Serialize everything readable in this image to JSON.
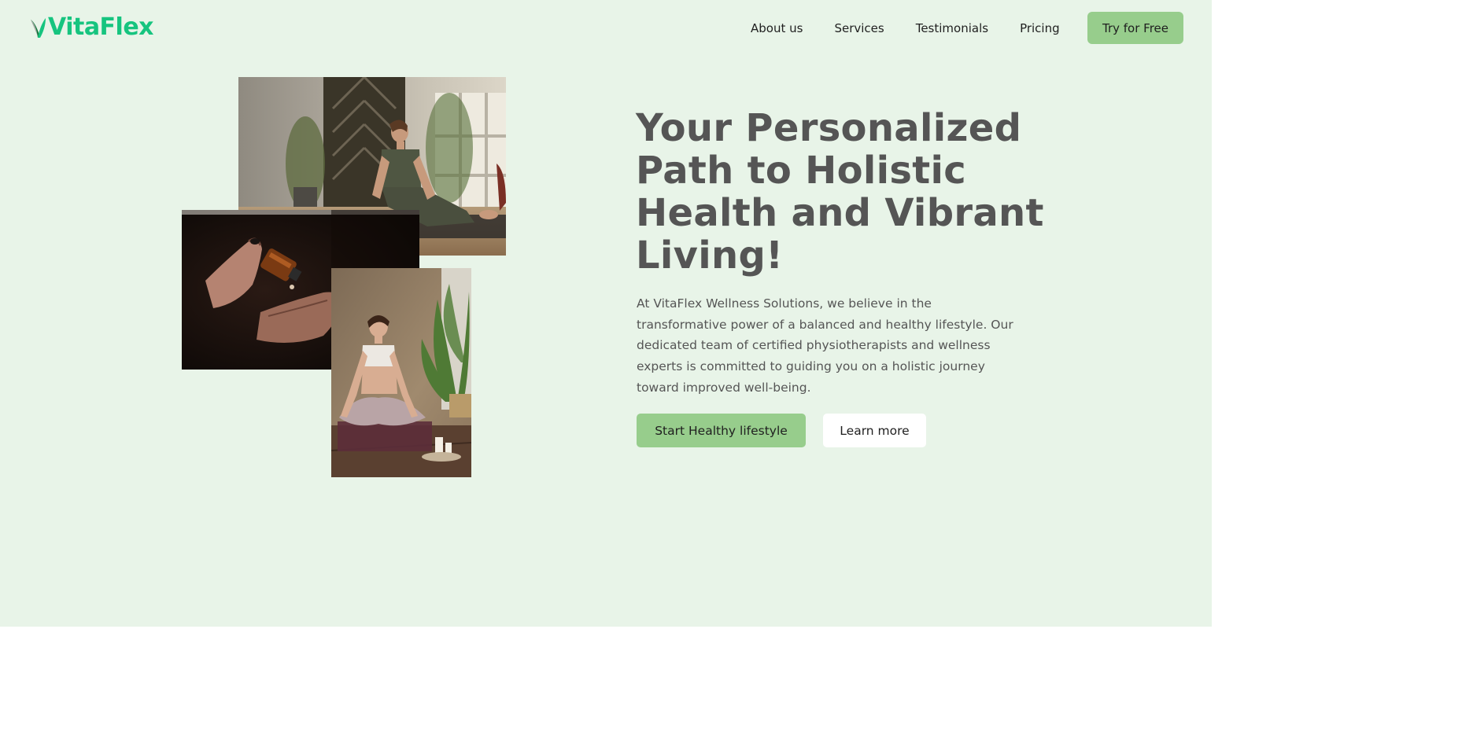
{
  "brand": {
    "name": "VitaFlex",
    "logo_icon": "leaf-icon",
    "color": "#16c47f"
  },
  "nav": {
    "items": [
      {
        "label": "About us"
      },
      {
        "label": "Services"
      },
      {
        "label": "Testimonials"
      },
      {
        "label": "Pricing"
      }
    ],
    "cta_label": "Try for Free"
  },
  "hero": {
    "title": "Your Personalized Path to Holistic Health and Vibrant Living!",
    "description": "At VitaFlex Wellness Solutions, we believe in the transformative power of a balanced and healthy lifestyle. Our dedicated team of certified physiotherapists and wellness experts is committed to guiding you on a holistic journey toward improved well-being.",
    "primary_button": "Start Healthy lifestyle",
    "secondary_button": "Learn more"
  },
  "collage": {
    "images": [
      {
        "name": "yoga-stretch-photo"
      },
      {
        "name": "oil-dropper-photo"
      },
      {
        "name": "meditation-photo"
      }
    ]
  },
  "colors": {
    "background": "#e8f4e8",
    "accent": "#97cd8c",
    "heading": "#555555",
    "text": "#1f1f1f"
  }
}
